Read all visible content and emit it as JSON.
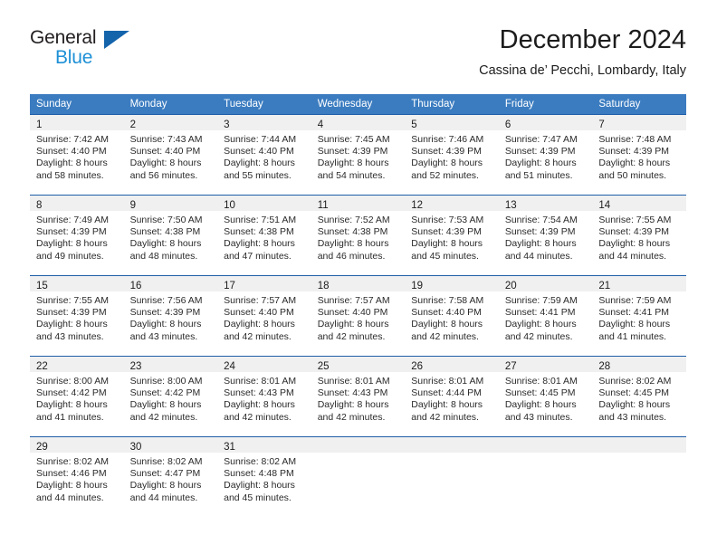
{
  "brand": {
    "name_part1": "General",
    "name_part2": "Blue",
    "triangle_color": "#1464ac",
    "blue_color": "#1e90d6"
  },
  "header": {
    "title": "December 2024",
    "subtitle": "Cassina de’ Pecchi, Lombardy, Italy"
  },
  "theme": {
    "header_bg": "#3b7cc0",
    "row_divider": "#1f5ea8",
    "daynum_bg": "#f0f0f0"
  },
  "weekdays": [
    "Sunday",
    "Monday",
    "Tuesday",
    "Wednesday",
    "Thursday",
    "Friday",
    "Saturday"
  ],
  "weeks": [
    [
      {
        "day": "1",
        "sunrise": "Sunrise: 7:42 AM",
        "sunset": "Sunset: 4:40 PM",
        "daylight1": "Daylight: 8 hours",
        "daylight2": "and 58 minutes."
      },
      {
        "day": "2",
        "sunrise": "Sunrise: 7:43 AM",
        "sunset": "Sunset: 4:40 PM",
        "daylight1": "Daylight: 8 hours",
        "daylight2": "and 56 minutes."
      },
      {
        "day": "3",
        "sunrise": "Sunrise: 7:44 AM",
        "sunset": "Sunset: 4:40 PM",
        "daylight1": "Daylight: 8 hours",
        "daylight2": "and 55 minutes."
      },
      {
        "day": "4",
        "sunrise": "Sunrise: 7:45 AM",
        "sunset": "Sunset: 4:39 PM",
        "daylight1": "Daylight: 8 hours",
        "daylight2": "and 54 minutes."
      },
      {
        "day": "5",
        "sunrise": "Sunrise: 7:46 AM",
        "sunset": "Sunset: 4:39 PM",
        "daylight1": "Daylight: 8 hours",
        "daylight2": "and 52 minutes."
      },
      {
        "day": "6",
        "sunrise": "Sunrise: 7:47 AM",
        "sunset": "Sunset: 4:39 PM",
        "daylight1": "Daylight: 8 hours",
        "daylight2": "and 51 minutes."
      },
      {
        "day": "7",
        "sunrise": "Sunrise: 7:48 AM",
        "sunset": "Sunset: 4:39 PM",
        "daylight1": "Daylight: 8 hours",
        "daylight2": "and 50 minutes."
      }
    ],
    [
      {
        "day": "8",
        "sunrise": "Sunrise: 7:49 AM",
        "sunset": "Sunset: 4:39 PM",
        "daylight1": "Daylight: 8 hours",
        "daylight2": "and 49 minutes."
      },
      {
        "day": "9",
        "sunrise": "Sunrise: 7:50 AM",
        "sunset": "Sunset: 4:38 PM",
        "daylight1": "Daylight: 8 hours",
        "daylight2": "and 48 minutes."
      },
      {
        "day": "10",
        "sunrise": "Sunrise: 7:51 AM",
        "sunset": "Sunset: 4:38 PM",
        "daylight1": "Daylight: 8 hours",
        "daylight2": "and 47 minutes."
      },
      {
        "day": "11",
        "sunrise": "Sunrise: 7:52 AM",
        "sunset": "Sunset: 4:38 PM",
        "daylight1": "Daylight: 8 hours",
        "daylight2": "and 46 minutes."
      },
      {
        "day": "12",
        "sunrise": "Sunrise: 7:53 AM",
        "sunset": "Sunset: 4:39 PM",
        "daylight1": "Daylight: 8 hours",
        "daylight2": "and 45 minutes."
      },
      {
        "day": "13",
        "sunrise": "Sunrise: 7:54 AM",
        "sunset": "Sunset: 4:39 PM",
        "daylight1": "Daylight: 8 hours",
        "daylight2": "and 44 minutes."
      },
      {
        "day": "14",
        "sunrise": "Sunrise: 7:55 AM",
        "sunset": "Sunset: 4:39 PM",
        "daylight1": "Daylight: 8 hours",
        "daylight2": "and 44 minutes."
      }
    ],
    [
      {
        "day": "15",
        "sunrise": "Sunrise: 7:55 AM",
        "sunset": "Sunset: 4:39 PM",
        "daylight1": "Daylight: 8 hours",
        "daylight2": "and 43 minutes."
      },
      {
        "day": "16",
        "sunrise": "Sunrise: 7:56 AM",
        "sunset": "Sunset: 4:39 PM",
        "daylight1": "Daylight: 8 hours",
        "daylight2": "and 43 minutes."
      },
      {
        "day": "17",
        "sunrise": "Sunrise: 7:57 AM",
        "sunset": "Sunset: 4:40 PM",
        "daylight1": "Daylight: 8 hours",
        "daylight2": "and 42 minutes."
      },
      {
        "day": "18",
        "sunrise": "Sunrise: 7:57 AM",
        "sunset": "Sunset: 4:40 PM",
        "daylight1": "Daylight: 8 hours",
        "daylight2": "and 42 minutes."
      },
      {
        "day": "19",
        "sunrise": "Sunrise: 7:58 AM",
        "sunset": "Sunset: 4:40 PM",
        "daylight1": "Daylight: 8 hours",
        "daylight2": "and 42 minutes."
      },
      {
        "day": "20",
        "sunrise": "Sunrise: 7:59 AM",
        "sunset": "Sunset: 4:41 PM",
        "daylight1": "Daylight: 8 hours",
        "daylight2": "and 42 minutes."
      },
      {
        "day": "21",
        "sunrise": "Sunrise: 7:59 AM",
        "sunset": "Sunset: 4:41 PM",
        "daylight1": "Daylight: 8 hours",
        "daylight2": "and 41 minutes."
      }
    ],
    [
      {
        "day": "22",
        "sunrise": "Sunrise: 8:00 AM",
        "sunset": "Sunset: 4:42 PM",
        "daylight1": "Daylight: 8 hours",
        "daylight2": "and 41 minutes."
      },
      {
        "day": "23",
        "sunrise": "Sunrise: 8:00 AM",
        "sunset": "Sunset: 4:42 PM",
        "daylight1": "Daylight: 8 hours",
        "daylight2": "and 42 minutes."
      },
      {
        "day": "24",
        "sunrise": "Sunrise: 8:01 AM",
        "sunset": "Sunset: 4:43 PM",
        "daylight1": "Daylight: 8 hours",
        "daylight2": "and 42 minutes."
      },
      {
        "day": "25",
        "sunrise": "Sunrise: 8:01 AM",
        "sunset": "Sunset: 4:43 PM",
        "daylight1": "Daylight: 8 hours",
        "daylight2": "and 42 minutes."
      },
      {
        "day": "26",
        "sunrise": "Sunrise: 8:01 AM",
        "sunset": "Sunset: 4:44 PM",
        "daylight1": "Daylight: 8 hours",
        "daylight2": "and 42 minutes."
      },
      {
        "day": "27",
        "sunrise": "Sunrise: 8:01 AM",
        "sunset": "Sunset: 4:45 PM",
        "daylight1": "Daylight: 8 hours",
        "daylight2": "and 43 minutes."
      },
      {
        "day": "28",
        "sunrise": "Sunrise: 8:02 AM",
        "sunset": "Sunset: 4:45 PM",
        "daylight1": "Daylight: 8 hours",
        "daylight2": "and 43 minutes."
      }
    ],
    [
      {
        "day": "29",
        "sunrise": "Sunrise: 8:02 AM",
        "sunset": "Sunset: 4:46 PM",
        "daylight1": "Daylight: 8 hours",
        "daylight2": "and 44 minutes."
      },
      {
        "day": "30",
        "sunrise": "Sunrise: 8:02 AM",
        "sunset": "Sunset: 4:47 PM",
        "daylight1": "Daylight: 8 hours",
        "daylight2": "and 44 minutes."
      },
      {
        "day": "31",
        "sunrise": "Sunrise: 8:02 AM",
        "sunset": "Sunset: 4:48 PM",
        "daylight1": "Daylight: 8 hours",
        "daylight2": "and 45 minutes."
      },
      {
        "day": "",
        "sunrise": "",
        "sunset": "",
        "daylight1": "",
        "daylight2": ""
      },
      {
        "day": "",
        "sunrise": "",
        "sunset": "",
        "daylight1": "",
        "daylight2": ""
      },
      {
        "day": "",
        "sunrise": "",
        "sunset": "",
        "daylight1": "",
        "daylight2": ""
      },
      {
        "day": "",
        "sunrise": "",
        "sunset": "",
        "daylight1": "",
        "daylight2": ""
      }
    ]
  ]
}
